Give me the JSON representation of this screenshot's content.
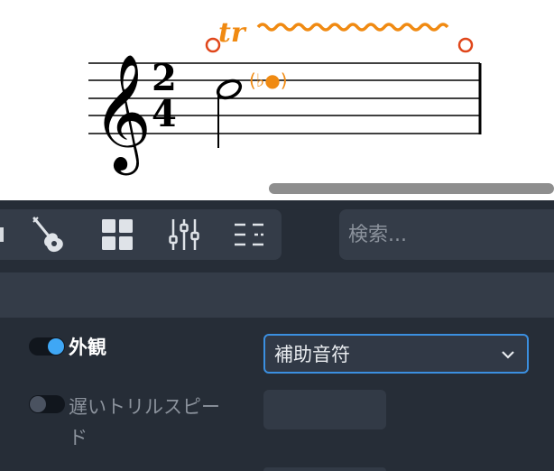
{
  "score": {
    "time_signature": {
      "top": "2",
      "bottom": "4"
    },
    "trill_symbol": "tr",
    "accidental_glyph": "(♭●)",
    "accent_color": "#f08a12",
    "handle_color": "#e0461a"
  },
  "toolbar": {
    "buttons": [
      {
        "name": "instrument-guitar-icon"
      },
      {
        "name": "grid-icon"
      },
      {
        "name": "mixer-sliders-icon"
      },
      {
        "name": "list-outline-icon"
      }
    ],
    "search_placeholder": "検索..."
  },
  "properties": {
    "appearance": {
      "label": "外観",
      "enabled": true,
      "value": "補助音符"
    },
    "slow_trill": {
      "label_line1": "遅いトリルスピー",
      "label_line2": "ド",
      "enabled": false,
      "value": ""
    }
  },
  "colors": {
    "panel_bg": "#262d37",
    "toggle_on": "#3fa7f5",
    "toggle_off": "#4a5260",
    "select_border": "#3b8fe0"
  }
}
